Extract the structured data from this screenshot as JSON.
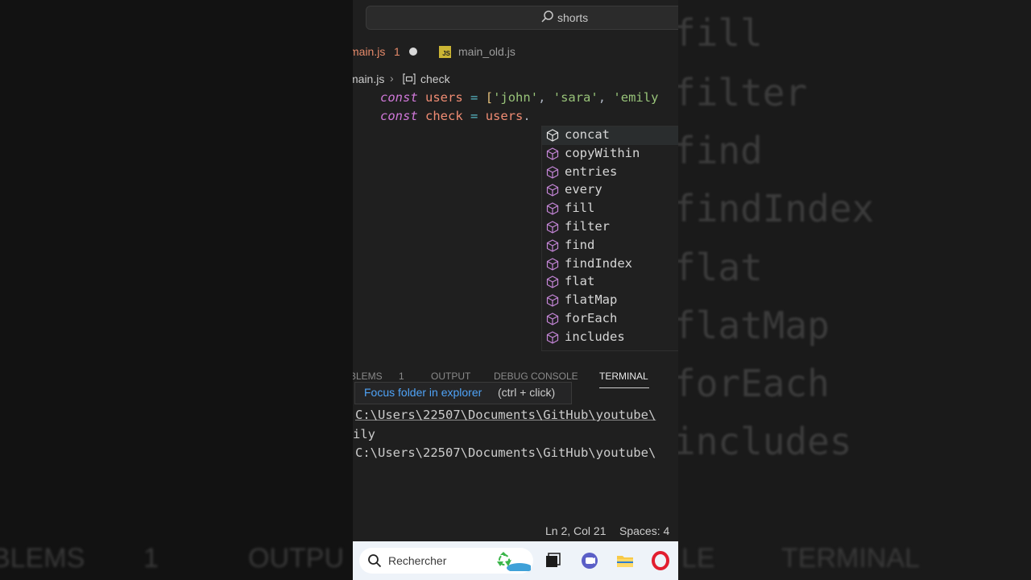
{
  "background": {
    "right_words": [
      "fill",
      "filter",
      "find",
      "findIndex",
      "flat",
      "flatMap",
      "forEach",
      "includes"
    ],
    "bottom_tabs": [
      "BLEMS",
      "1",
      "OUTPU",
      "LE",
      "TERMINAL"
    ]
  },
  "titlebar": {
    "search_text": "shorts",
    "search_icon": "search-icon"
  },
  "tabs": [
    {
      "label": "main.js",
      "problems": "1",
      "modified": true,
      "color": "#e58a6a"
    },
    {
      "label": "main_old.js",
      "icon": "js-file-icon"
    }
  ],
  "breadcrumb": {
    "file": "main.js",
    "symbol": "check",
    "symbol_icon": "variable-icon"
  },
  "code": {
    "line1": {
      "kw": "const",
      "name": "users",
      "op": "=",
      "open": "[",
      "s1": "'john'",
      "s2": "'sara'",
      "s3": "'emily"
    },
    "line2": {
      "kw": "const",
      "name": "check",
      "op": "=",
      "obj": "users",
      "dot": "."
    }
  },
  "suggestions": {
    "selected_index": 0,
    "icon": "method-cube-icon",
    "items": [
      "concat",
      "copyWithin",
      "entries",
      "every",
      "fill",
      "filter",
      "find",
      "findIndex",
      "flat",
      "flatMap",
      "forEach",
      "includes"
    ]
  },
  "panel": {
    "tabs": [
      {
        "label": "BLEMS"
      },
      {
        "label": "1"
      },
      {
        "label": "OUTPUT"
      },
      {
        "label": "DEBUG CONSOLE"
      },
      {
        "label": "TERMINAL",
        "active": true
      }
    ],
    "tooltip": {
      "link": "Focus folder in explorer",
      "hint": "(ctrl + click)"
    },
    "terminal_lines": [
      "C:\\Users\\22507\\Documents\\GitHub\\youtube\\",
      "ily",
      "C:\\Users\\22507\\Documents\\GitHub\\youtube\\"
    ]
  },
  "statusbar": {
    "position": "Ln 2, Col 21",
    "spaces": "Spaces: 4"
  },
  "taskbar": {
    "search_placeholder": "Rechercher",
    "apps": [
      "task-view-icon",
      "teams-chat-icon",
      "file-explorer-icon",
      "opera-browser-icon"
    ]
  },
  "colors": {
    "keyword": "#cf78d8",
    "variable": "#f08c73",
    "operator": "#56b6c2",
    "string": "#98c379",
    "link": "#4fa3f7"
  }
}
